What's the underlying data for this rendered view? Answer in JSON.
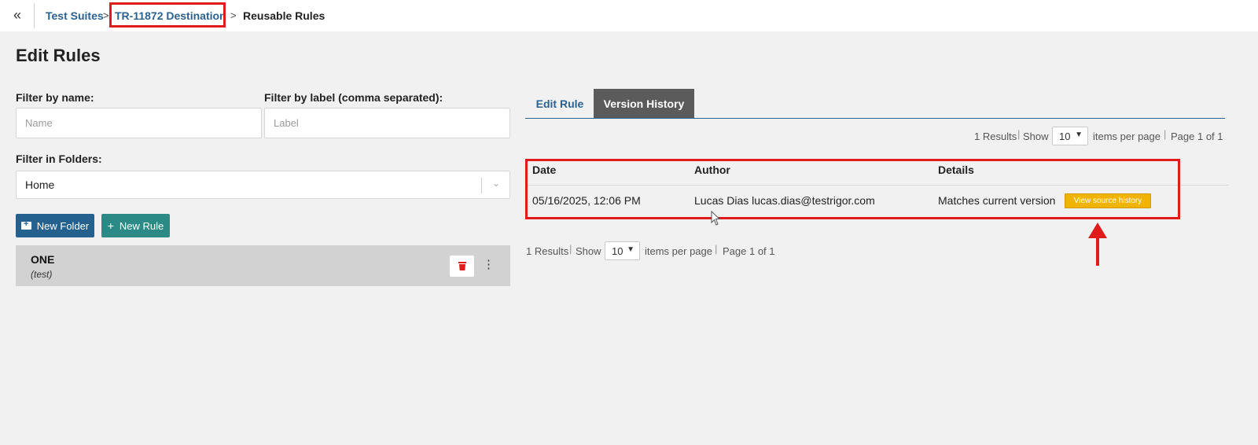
{
  "topbar": {
    "collapse_glyph": "«",
    "breadcrumbs": [
      {
        "label": "Test Suites"
      },
      {
        "label": "TR-11872 Destination"
      },
      {
        "label": "Reusable Rules"
      }
    ],
    "separator": ">"
  },
  "left": {
    "title": "Edit Rules",
    "filter_name": {
      "label": "Filter by name:",
      "placeholder": "Name",
      "value": ""
    },
    "filter_label": {
      "label": "Filter by label (comma separated):",
      "placeholder": "Label",
      "value": ""
    },
    "filter_folders": {
      "label": "Filter in Folders:",
      "selected": "Home"
    },
    "buttons": {
      "new_folder": "New Folder",
      "new_rule": "New Rule",
      "new_rule_icon": "+"
    },
    "rules": [
      {
        "name": "ONE",
        "label": "(test)"
      }
    ]
  },
  "right": {
    "tabs": [
      {
        "label": "Edit Rule",
        "active": false
      },
      {
        "label": "Version History",
        "active": true
      }
    ],
    "pager": {
      "results": "1 Results",
      "show": "Show",
      "per_page": "10",
      "items_per_page": "items per page",
      "page": "Page 1 of 1"
    },
    "table": {
      "headers": [
        "Date",
        "Author",
        "Details"
      ],
      "rows": [
        {
          "date": "05/16/2025, 12:06 PM",
          "author": "Lucas Dias lucas.dias@testrigor.com",
          "details": "Matches current version",
          "action": "View source history"
        }
      ]
    }
  },
  "colors": {
    "link": "#2a6293",
    "annotation_red": "#e01b1b",
    "active_tab": "#5b5b5b",
    "new_folder_btn": "#24618f",
    "new_rule_btn": "#2b8a86",
    "view_source_btn": "#f0b400",
    "delete_icon": "#e01b1b"
  },
  "icons": {
    "collapse": "double-chevron-left-icon",
    "folder_add": "folder-plus-icon",
    "delete": "trash-icon",
    "more": "vertical-dots-icon",
    "dropdown": "chevron-down-icon"
  }
}
